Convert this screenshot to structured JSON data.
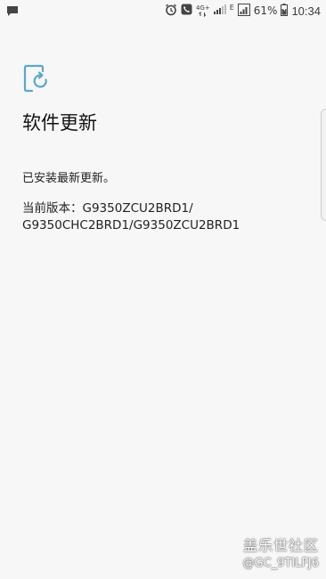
{
  "status_bar": {
    "battery_percent": "61%",
    "time": "10:34",
    "network_label": "4G+",
    "network_sub": "E",
    "icons": [
      "message-icon",
      "alarm-icon",
      "call-icon",
      "signal-icon",
      "battery-icon"
    ]
  },
  "page": {
    "title": "软件更新",
    "status_message": "已安装最新更新。",
    "version_line1": "当前版本：G9350ZCU2BRD1/",
    "version_line2": "G9350CHC2BRD1/G9350ZCU2BRD1"
  },
  "watermark": {
    "site": "盖乐世社区",
    "user": "@GC_9TILFJ6"
  },
  "colors": {
    "accent": "#5aa9c8",
    "background": "#f7f7f7"
  }
}
